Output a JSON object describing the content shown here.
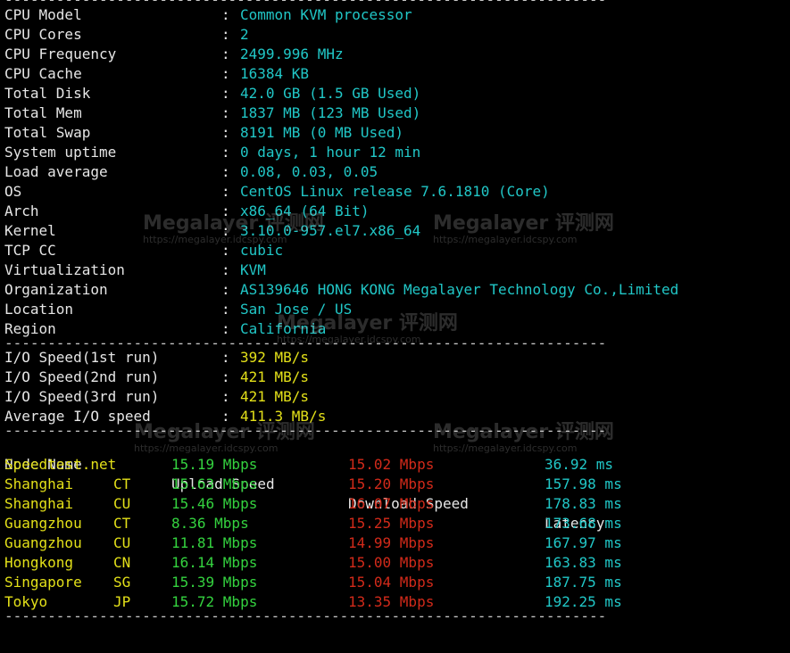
{
  "separator": "----------------------------------------------------------------------",
  "sysinfo": [
    {
      "key": "CPU Model",
      "value": "Common KVM processor"
    },
    {
      "key": "CPU Cores",
      "value": "2"
    },
    {
      "key": "CPU Frequency",
      "value": "2499.996 MHz"
    },
    {
      "key": "CPU Cache",
      "value": "16384 KB"
    },
    {
      "key": "Total Disk",
      "value": "42.0 GB (1.5 GB Used)"
    },
    {
      "key": "Total Mem",
      "value": "1837 MB (123 MB Used)"
    },
    {
      "key": "Total Swap",
      "value": "8191 MB (0 MB Used)"
    },
    {
      "key": "System uptime",
      "value": "0 days, 1 hour 12 min"
    },
    {
      "key": "Load average",
      "value": "0.08, 0.03, 0.05"
    },
    {
      "key": "OS",
      "value": "CentOS Linux release 7.6.1810 (Core)"
    },
    {
      "key": "Arch",
      "value": "x86_64 (64 Bit)"
    },
    {
      "key": "Kernel",
      "value": "3.10.0-957.el7.x86_64"
    },
    {
      "key": "TCP CC",
      "value": "cubic"
    },
    {
      "key": "Virtualization",
      "value": "KVM"
    },
    {
      "key": "Organization",
      "value": "AS139646 HONG KONG Megalayer Technology Co.,Limited"
    },
    {
      "key": "Location",
      "value": "San Jose / US"
    },
    {
      "key": "Region",
      "value": "California"
    }
  ],
  "io": [
    {
      "key": "I/O Speed(1st run)",
      "value": "392 MB/s"
    },
    {
      "key": "I/O Speed(2nd run)",
      "value": "421 MB/s"
    },
    {
      "key": "I/O Speed(3rd run)",
      "value": "421 MB/s"
    },
    {
      "key": "Average I/O speed",
      "value": "411.3 MB/s"
    }
  ],
  "speed_header": {
    "node": "Node Name",
    "upload": "Upload Speed",
    "download": "Download Speed",
    "latency": "Latency"
  },
  "speedtests": [
    {
      "node": "Speedtest.net",
      "isp": "",
      "upload": "15.19 Mbps",
      "download": "15.02 Mbps",
      "latency": "36.92 ms"
    },
    {
      "node": "Shanghai",
      "isp": "CT",
      "upload": "15.63 Mbps",
      "download": "15.20 Mbps",
      "latency": "157.98 ms"
    },
    {
      "node": "Shanghai",
      "isp": "CU",
      "upload": "15.46 Mbps",
      "download": "16.07 Mbps",
      "latency": "178.83 ms"
    },
    {
      "node": "Guangzhou",
      "isp": "CT",
      "upload": "8.36 Mbps",
      "download": "15.25 Mbps",
      "latency": "173.68 ms"
    },
    {
      "node": "Guangzhou",
      "isp": "CU",
      "upload": "11.81 Mbps",
      "download": "14.99 Mbps",
      "latency": "167.97 ms"
    },
    {
      "node": "Hongkong",
      "isp": "CN",
      "upload": "16.14 Mbps",
      "download": "15.00 Mbps",
      "latency": "163.83 ms"
    },
    {
      "node": "Singapore",
      "isp": "SG",
      "upload": "15.39 Mbps",
      "download": "15.04 Mbps",
      "latency": "187.75 ms"
    },
    {
      "node": "Tokyo",
      "isp": "JP",
      "upload": "15.72 Mbps",
      "download": "13.35 Mbps",
      "latency": "192.25 ms"
    }
  ],
  "watermark": {
    "brand": "Megalayer 评测网",
    "url": "https://megalayer.idcspy.com"
  },
  "colors": {
    "background": "#000000",
    "label": "#e6e6e6",
    "value": "#21c7c7",
    "io": "#e3e019",
    "upload": "#34d23f",
    "download": "#d22a1a",
    "latency": "#21c7c7",
    "node": "#e3e019"
  }
}
